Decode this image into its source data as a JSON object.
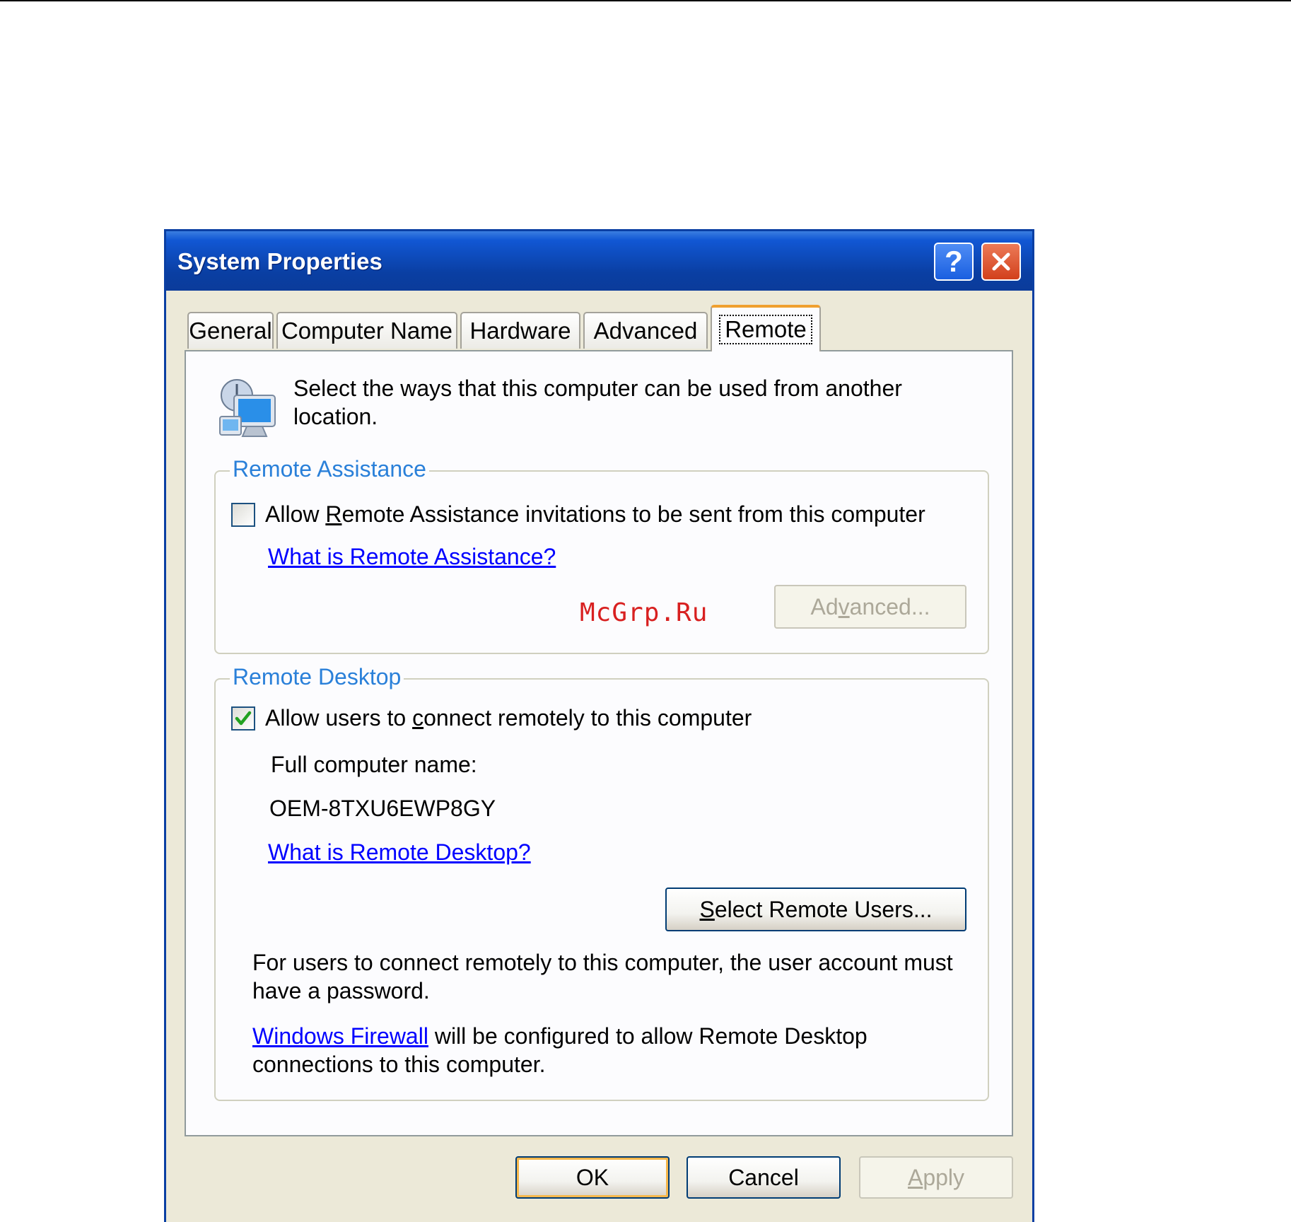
{
  "window": {
    "title": "System Properties",
    "help_label": "?"
  },
  "tabs": [
    {
      "label": "General"
    },
    {
      "label": "Computer Name"
    },
    {
      "label": "Hardware"
    },
    {
      "label": "Advanced"
    },
    {
      "label": "Remote",
      "active": true
    }
  ],
  "intro": {
    "icon": "remote-computer-icon",
    "text": "Select the ways that this computer can be used from another location."
  },
  "remote_assistance": {
    "legend": "Remote Assistance",
    "checkbox_before": "Allow ",
    "checkbox_mnemonic": "R",
    "checkbox_after": "emote Assistance invitations to be sent from this computer",
    "checked": false,
    "link": "What is Remote Assistance?",
    "advanced_before": "Ad",
    "advanced_mnemonic": "v",
    "advanced_after": "anced..."
  },
  "remote_desktop": {
    "legend": "Remote Desktop",
    "checkbox_before": "Allow users to ",
    "checkbox_mnemonic": "c",
    "checkbox_after": "onnect remotely to this computer",
    "checked": true,
    "computer_name_label": "Full computer name:",
    "computer_name_value": "OEM-8TXU6EWP8GY",
    "link": "What is Remote Desktop?",
    "select_users_mnemonic": "S",
    "select_users_after": "elect Remote Users...",
    "note": "For users to connect remotely to this computer, the user account must have a password.",
    "firewall_link": "Windows Firewall",
    "firewall_text": " will be configured to allow Remote Desktop connections to this computer."
  },
  "buttons": {
    "ok": "OK",
    "cancel": "Cancel",
    "apply_mnemonic": "A",
    "apply_after": "pply"
  },
  "watermark": "McGrp.Ru",
  "colors": {
    "titlebar": "#0a3fa3",
    "legend": "#2a80d9",
    "link": "#0000ff",
    "check": "#21a121",
    "watermark": "#d82020"
  }
}
